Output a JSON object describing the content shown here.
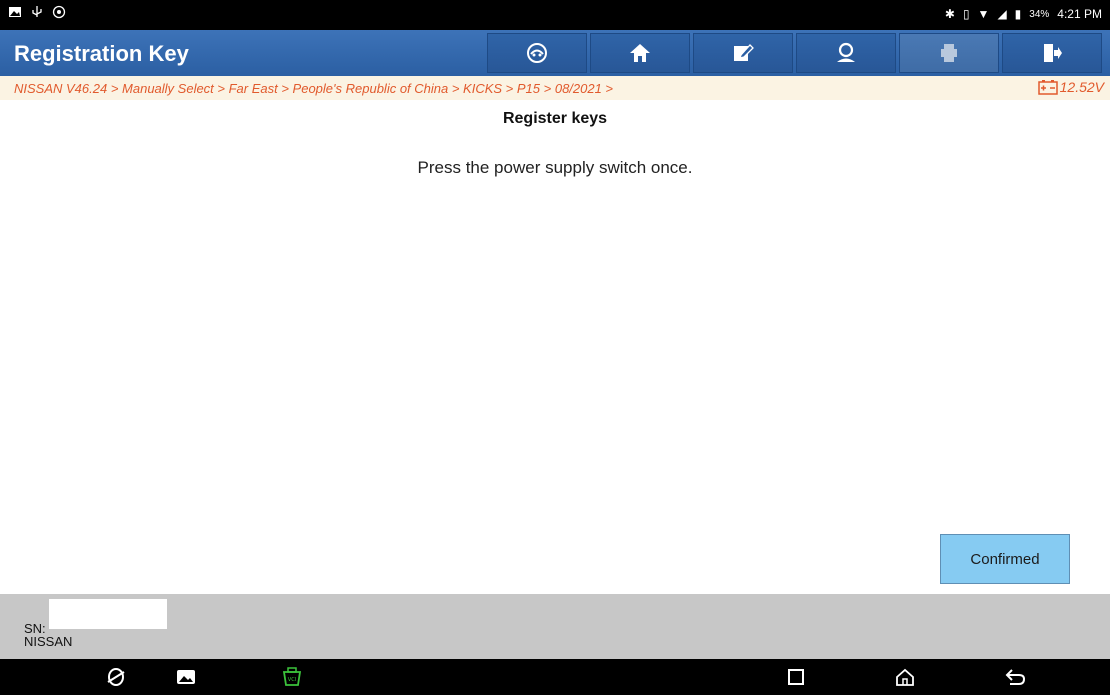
{
  "status_bar": {
    "battery_percent": "34%",
    "time": "4:21 PM"
  },
  "header": {
    "title": "Registration Key",
    "buttons": [
      {
        "name": "vehicle-icon"
      },
      {
        "name": "home-icon"
      },
      {
        "name": "edit-report-icon"
      },
      {
        "name": "remote-support-icon"
      },
      {
        "name": "print-icon"
      },
      {
        "name": "exit-icon"
      }
    ]
  },
  "breadcrumb": {
    "path": "NISSAN V46.24 > Manually Select > Far East > People's Republic of China > KICKS > P15 > 08/2021 >",
    "voltage": "12.52V"
  },
  "content": {
    "heading": "Register keys",
    "message": "Press the power supply switch once."
  },
  "actions": {
    "confirm_label": "Confirmed"
  },
  "footer": {
    "sn_label": "SN:",
    "make": "NISSAN"
  },
  "colors": {
    "header": "#2b5fa3",
    "breadcrumb_text": "#e15a2d",
    "confirm_button": "#86cbf2",
    "footer": "#c7c7c7"
  }
}
